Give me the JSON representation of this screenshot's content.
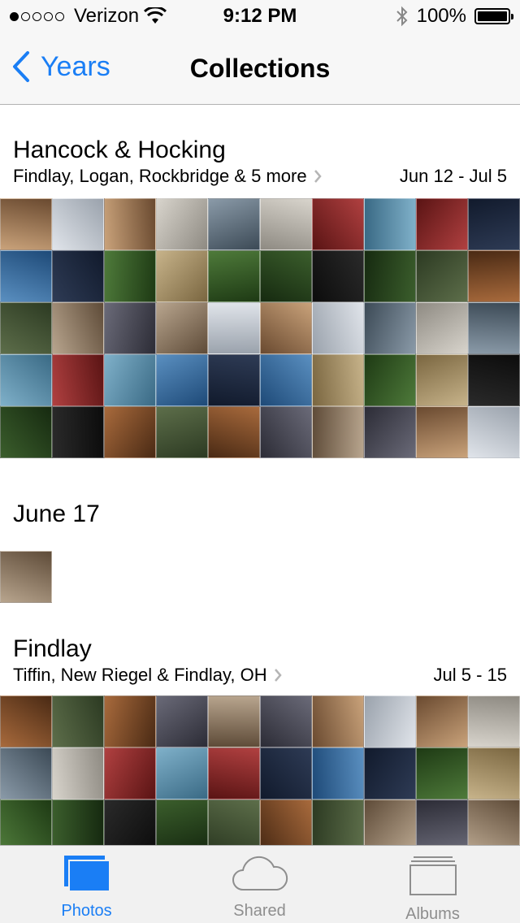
{
  "status_bar": {
    "carrier": "Verizon",
    "time": "9:12 PM",
    "battery": "100%"
  },
  "nav": {
    "back_label": "Years",
    "title": "Collections"
  },
  "sections": [
    {
      "title": "Hancock & Hocking",
      "subtitle": "Findlay, Logan, Rockbridge & 5 more",
      "dates": "Jun 12 - Jul 5",
      "photo_count_visible": 50
    },
    {
      "title": "June 17",
      "photo_count_visible": 1
    },
    {
      "title": "Findlay",
      "subtitle": "Tiffin, New Riegel & Findlay, OH",
      "dates": "Jul 5 - 15",
      "photo_count_visible": 30
    }
  ],
  "tabs": [
    {
      "label": "Photos",
      "icon": "photos-icon",
      "active": true
    },
    {
      "label": "Shared",
      "icon": "cloud-icon",
      "active": false
    },
    {
      "label": "Albums",
      "icon": "albums-icon",
      "active": false
    }
  ],
  "colors": {
    "accent": "#1a7ef5",
    "inactive_tab": "#8e8e8e"
  }
}
